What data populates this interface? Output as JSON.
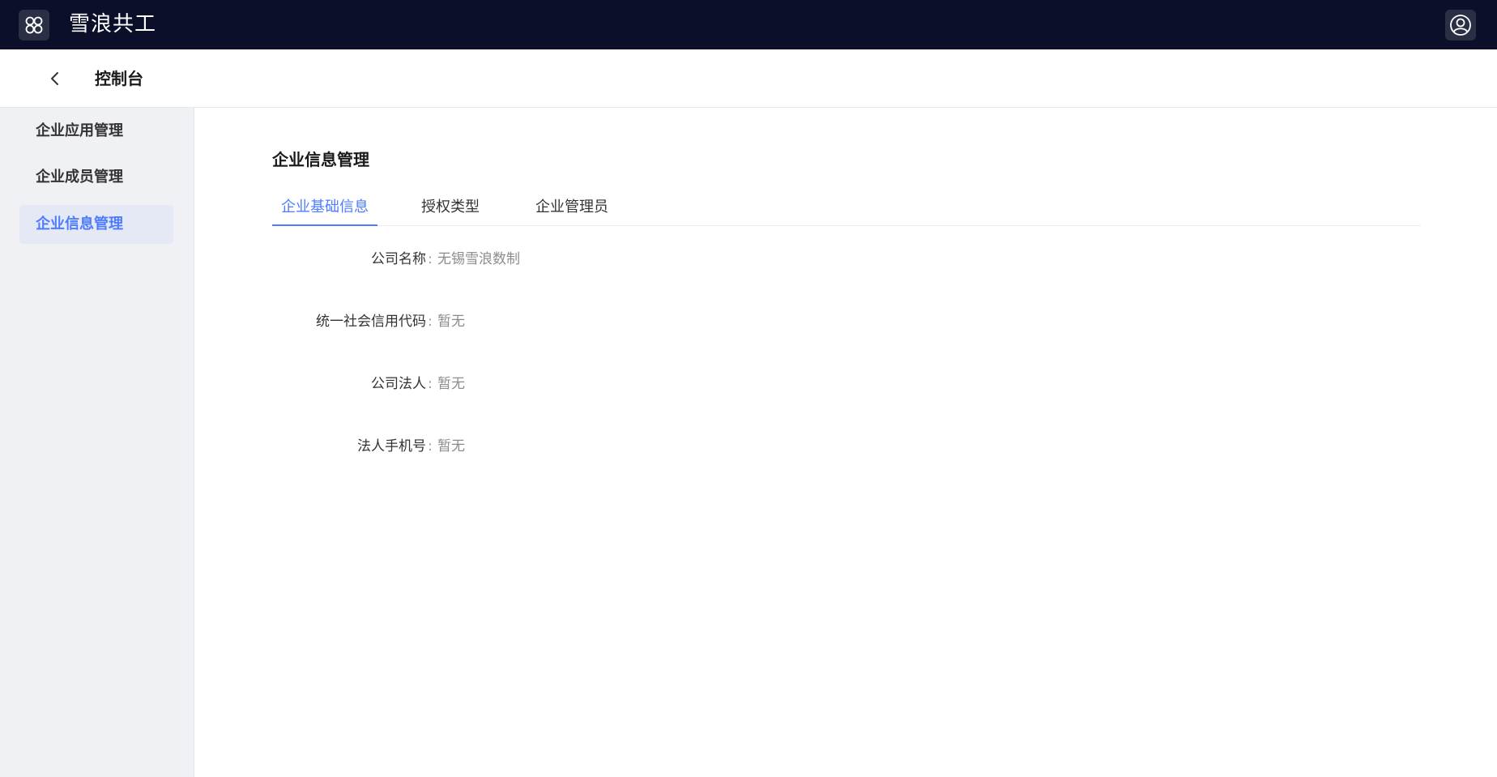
{
  "topbar": {
    "title": "雪浪共工",
    "apps_icon": "apps-grid-icon",
    "user_icon": "user-avatar-icon"
  },
  "subheader": {
    "back_icon": "chevron-left-icon",
    "title": "控制台"
  },
  "sidebar": {
    "items": [
      {
        "label": "企业应用管理",
        "active": false
      },
      {
        "label": "企业成员管理",
        "active": false
      },
      {
        "label": "企业信息管理",
        "active": true
      }
    ]
  },
  "main": {
    "title": "企业信息管理",
    "tabs": [
      {
        "label": "企业基础信息",
        "active": true
      },
      {
        "label": "授权类型",
        "active": false
      },
      {
        "label": "企业管理员",
        "active": false
      }
    ],
    "fields": [
      {
        "label": "公司名称",
        "colon": ":",
        "value": "无锡雪浪数制"
      },
      {
        "label": "统一社会信用代码",
        "colon": ":",
        "value": "暂无"
      },
      {
        "label": "公司法人",
        "colon": ":",
        "value": "暂无"
      },
      {
        "label": "法人手机号",
        "colon": ":",
        "value": "暂无"
      }
    ]
  },
  "colors": {
    "topbar_bg": "#0b0f2a",
    "accent": "#4e7cff",
    "sidebar_bg": "#f0f1f5",
    "sidebar_active_bg": "#e5e8f5"
  }
}
